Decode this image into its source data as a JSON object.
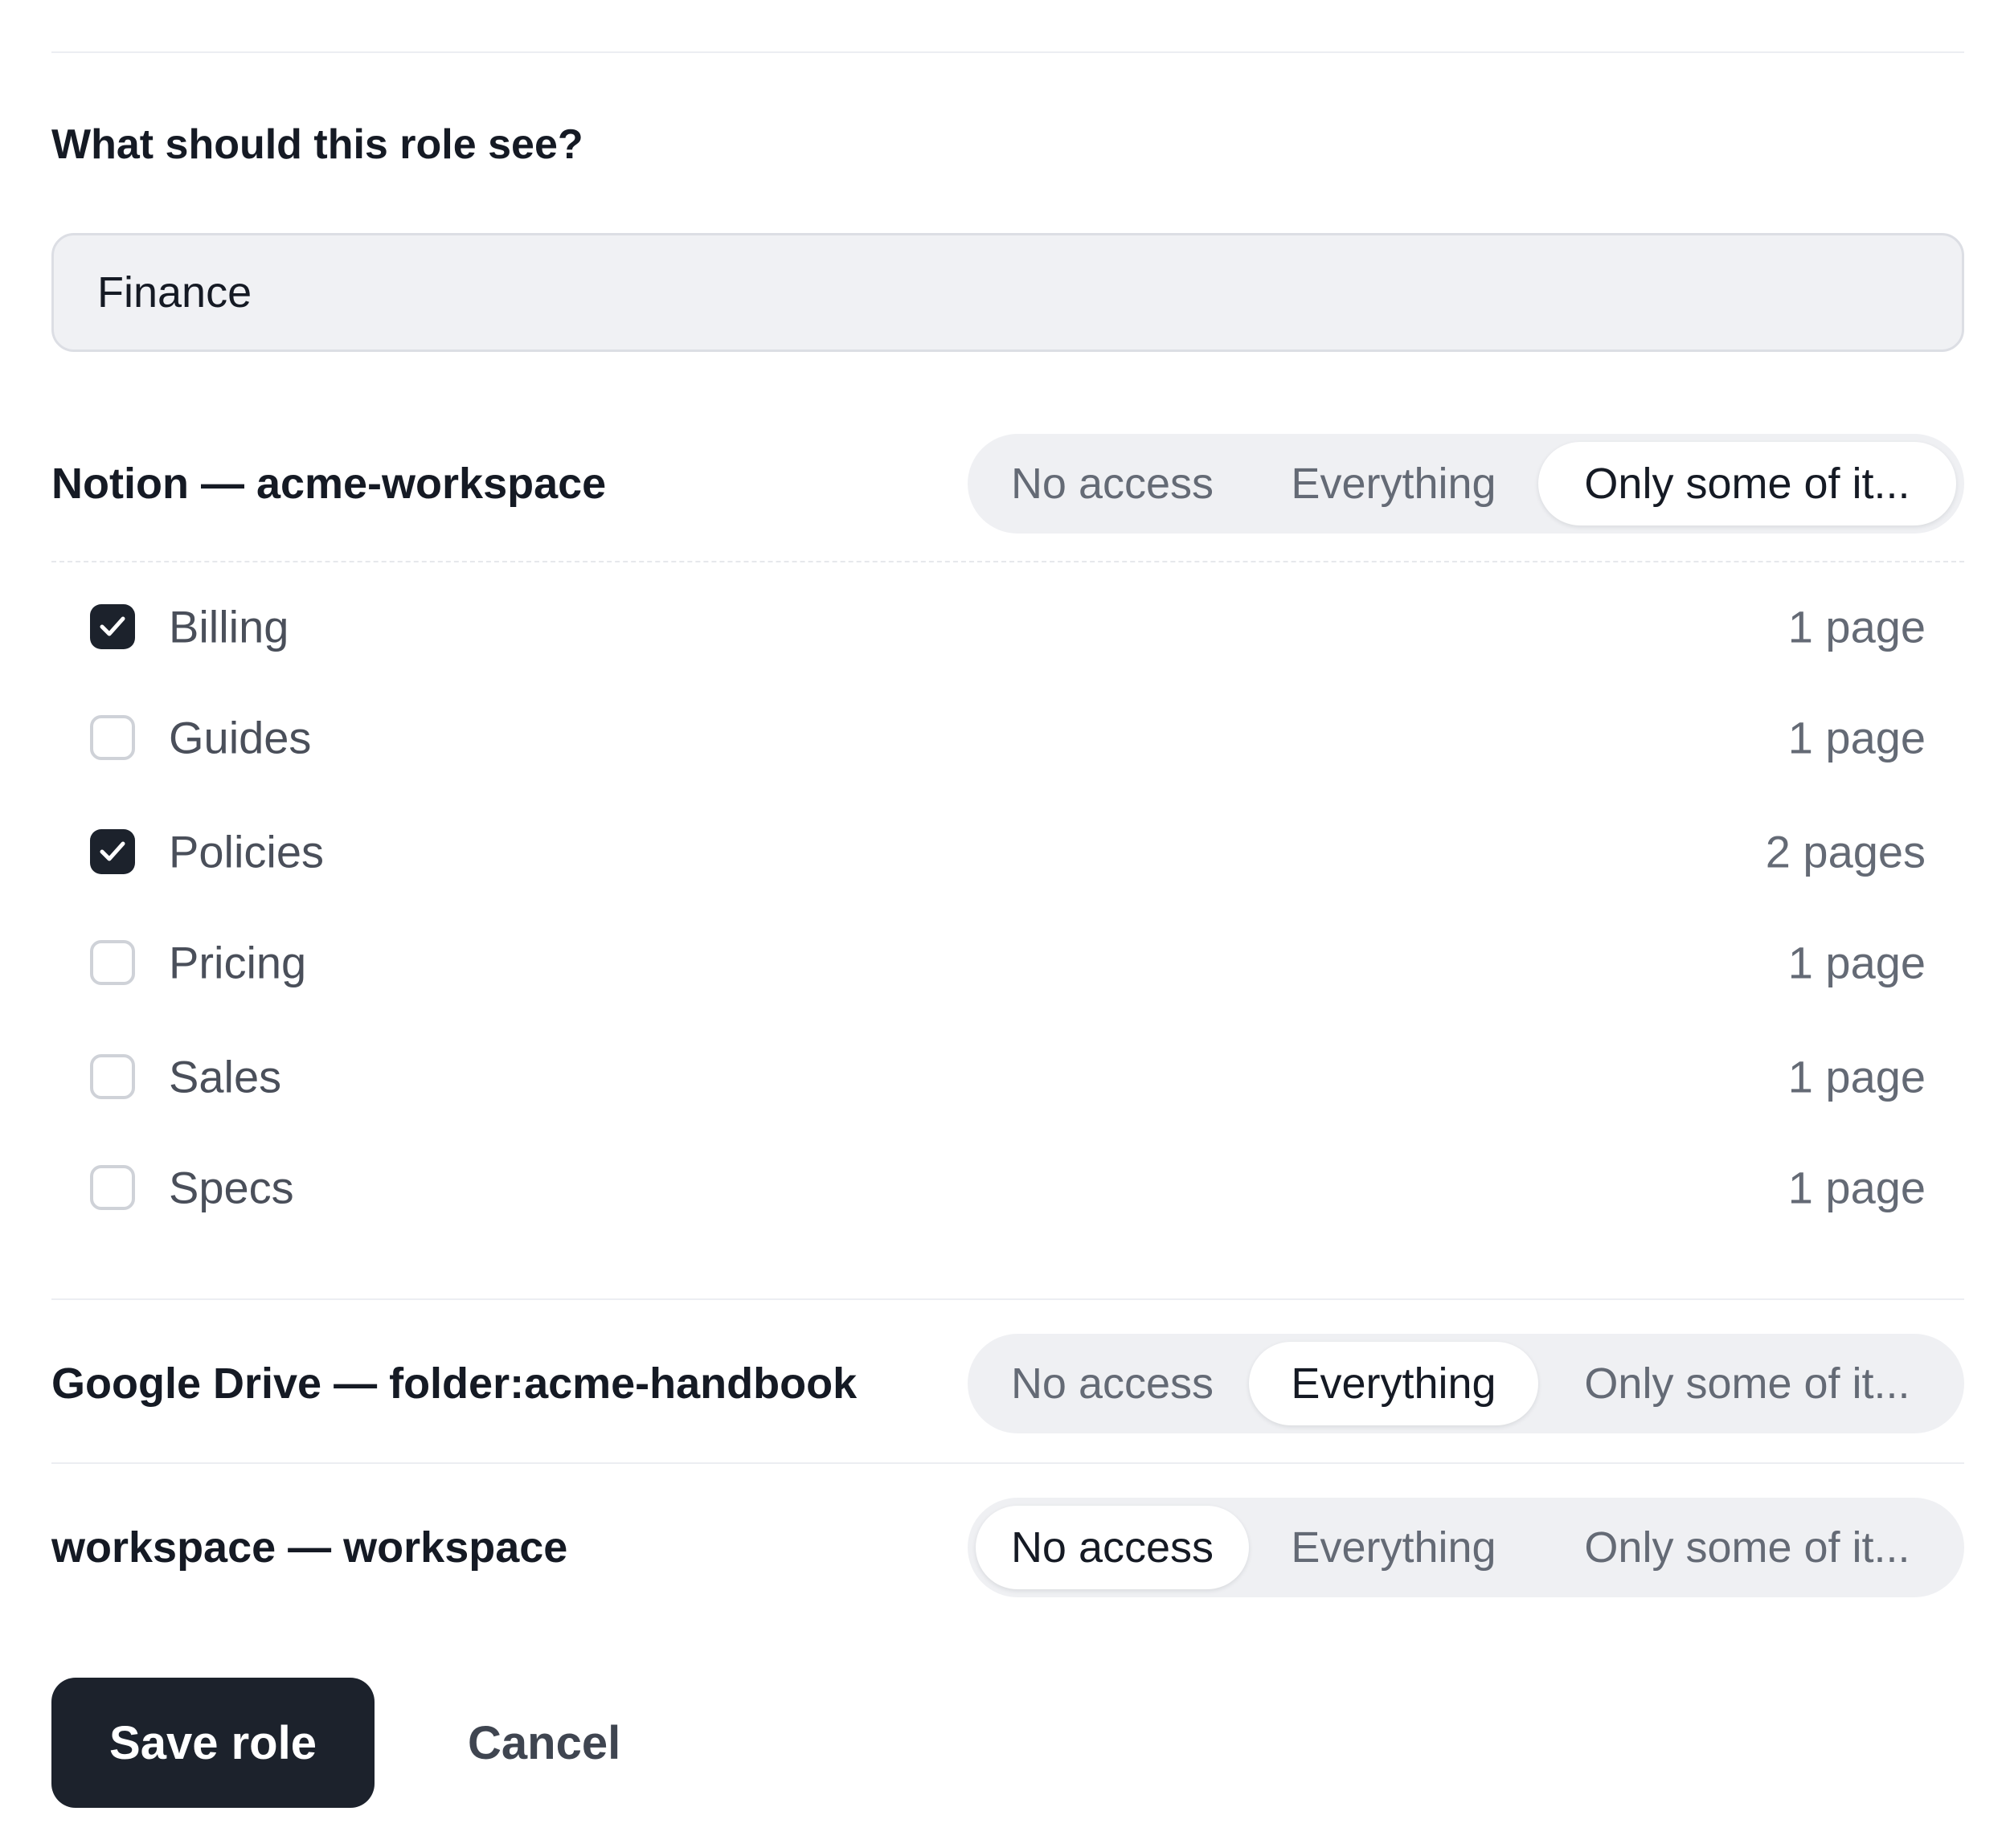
{
  "form": {
    "question": "What should this role see?",
    "role_name": "Finance"
  },
  "sources": [
    {
      "label": "Notion — acme-workspace",
      "options": [
        "No access",
        "Everything",
        "Only some of it..."
      ],
      "selected": "Only some of it..."
    },
    {
      "label": "Google Drive — folder:acme-handbook",
      "options": [
        "No access",
        "Everything",
        "Only some of it..."
      ],
      "selected": "Everything"
    },
    {
      "label": "workspace — workspace",
      "options": [
        "No access",
        "Everything",
        "Only some of it..."
      ],
      "selected": "No access"
    }
  ],
  "notion_folders": [
    {
      "name": "Billing",
      "count": "1 page",
      "checked": true
    },
    {
      "name": "Guides",
      "count": "1 page",
      "checked": false
    },
    {
      "name": "Policies",
      "count": "2 pages",
      "checked": true
    },
    {
      "name": "Pricing",
      "count": "1 page",
      "checked": false
    },
    {
      "name": "Sales",
      "count": "1 page",
      "checked": false
    },
    {
      "name": "Specs",
      "count": "1 page",
      "checked": false
    }
  ],
  "actions": {
    "save_label": "Save role",
    "cancel_label": "Cancel"
  },
  "colors": {
    "primary": "#1c222c",
    "segment_track": "#eff0f3",
    "input_background": "#f0f1f4",
    "muted_text": "#646a75"
  }
}
